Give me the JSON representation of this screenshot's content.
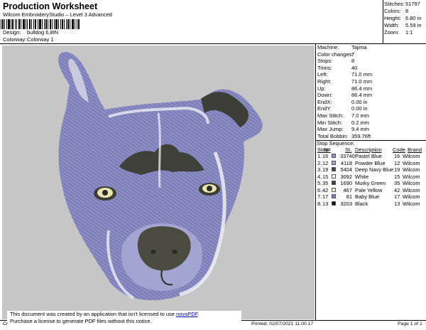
{
  "header": {
    "title": "Production Worksheet",
    "subtitle": "Wilcom EmbroideryStudio – Level 3 Advanced",
    "design_label": "Design:",
    "design_value": "bulldog 6,8IN",
    "colorway_label": "Colorway:",
    "colorway_value": "Colorway 1"
  },
  "summary": [
    {
      "label": "Stitches:",
      "value": "51797"
    },
    {
      "label": "Colors:",
      "value": "8"
    },
    {
      "label": "Height:",
      "value": "6.80 in"
    },
    {
      "label": "Width:",
      "value": "5.59 in"
    },
    {
      "label": "Zoom:",
      "value": "1:1"
    }
  ],
  "properties": [
    {
      "label": "Machine:",
      "value": "Tajima"
    },
    {
      "label": "Color changes:",
      "value": "7"
    },
    {
      "label": "Stops:",
      "value": "8"
    },
    {
      "label": "Trims:",
      "value": "40"
    },
    {
      "label": "Left:",
      "value": "71.0 mm"
    },
    {
      "label": "Right:",
      "value": "71.0 mm"
    },
    {
      "label": "Up:",
      "value": "86.4 mm"
    },
    {
      "label": "Down:",
      "value": "86.4 mm"
    },
    {
      "label": "EndX:",
      "value": "0.00 in"
    },
    {
      "label": "EndY:",
      "value": "0.00 in"
    },
    {
      "label": "Max Stitch:",
      "value": "7.0 mm"
    },
    {
      "label": "Min Stitch:",
      "value": "0.2 mm"
    },
    {
      "label": "Max Jump:",
      "value": "9.4 mm"
    },
    {
      "label": "Total Bobbin:",
      "value": "359.76ft"
    }
  ],
  "stop_sequence": {
    "title": "Stop Sequence:",
    "columns": {
      "stop": "Stop",
      "n": "N#",
      "st": "St.",
      "description": "Description",
      "code": "Code",
      "brand": "Brand"
    },
    "rows": [
      {
        "stop": "1.",
        "n": "16",
        "st": "33740",
        "description": "Pastel Blue",
        "code": "16",
        "brand": "Wilcom",
        "color": "#8a8ec6"
      },
      {
        "stop": "2.",
        "n": "12",
        "st": "4118",
        "description": "Powder Blue",
        "code": "12",
        "brand": "Wilcom",
        "color": "#a7a6cf"
      },
      {
        "stop": "3.",
        "n": "19",
        "st": "5404",
        "description": "Deep Navy Blue",
        "code": "19",
        "brand": "Wilcom",
        "color": "#46445a"
      },
      {
        "stop": "4.",
        "n": "15",
        "st": "3092",
        "description": "White",
        "code": "15",
        "brand": "Wilcom",
        "color": "#ffffff"
      },
      {
        "stop": "5.",
        "n": "35",
        "st": "1690",
        "description": "Murky Green",
        "code": "35",
        "brand": "Wilcom",
        "color": "#3c3e34"
      },
      {
        "stop": "6.",
        "n": "42",
        "st": "467",
        "description": "Pale Yellow",
        "code": "42",
        "brand": "Wilcom",
        "color": "#f2efc4"
      },
      {
        "stop": "7.",
        "n": "17",
        "st": "81",
        "description": "Baby Blue",
        "code": "17",
        "brand": "Wilcom",
        "color": "#7f83c8"
      },
      {
        "stop": "8.",
        "n": "13",
        "st": "3203",
        "description": "Black",
        "code": "13",
        "brand": "Wilcom",
        "color": "#111111"
      }
    ]
  },
  "notice": {
    "line1": "This document was created by an application that isn't licensed to use",
    "link": "novaPDF",
    "line2": "Purchase a license to generate PDF files without this notice."
  },
  "footer": {
    "left": "Cr",
    "printed": "Printed: 02/07/2021 11.00.17",
    "page": "Page 1 of 1"
  }
}
